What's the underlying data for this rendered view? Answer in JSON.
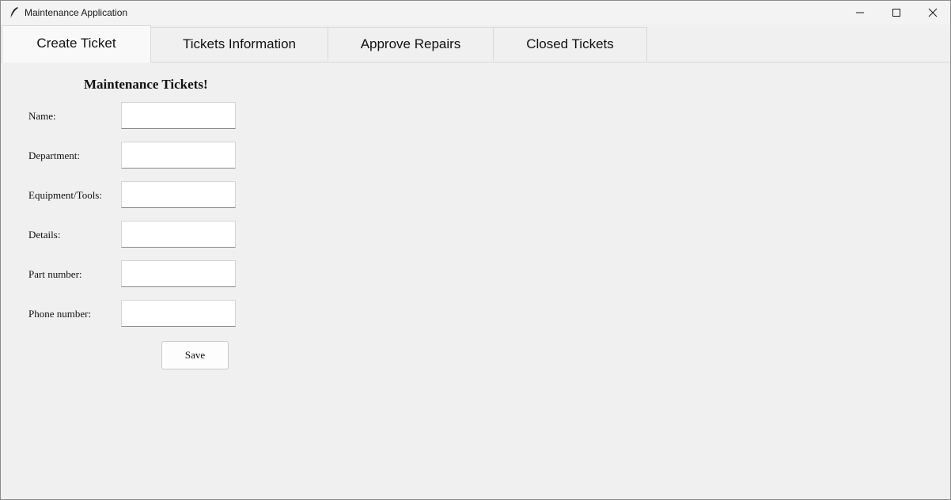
{
  "window": {
    "title": "Maintenance Application",
    "icon": "feather-icon"
  },
  "window_controls": {
    "minimize_icon": "minimize-icon",
    "maximize_icon": "maximize-icon",
    "close_icon": "close-icon"
  },
  "tabs": [
    {
      "label": "Create Ticket",
      "active": true
    },
    {
      "label": "Tickets Information",
      "active": false
    },
    {
      "label": "Approve Repairs",
      "active": false
    },
    {
      "label": "Closed Tickets",
      "active": false
    }
  ],
  "form": {
    "heading": "Maintenance Tickets!",
    "fields": [
      {
        "label": "Name:",
        "value": ""
      },
      {
        "label": "Department:",
        "value": ""
      },
      {
        "label": "Equipment/Tools:",
        "value": ""
      },
      {
        "label": "Details:",
        "value": ""
      },
      {
        "label": "Part number:",
        "value": ""
      },
      {
        "label": "Phone number:",
        "value": ""
      }
    ],
    "save_label": "Save"
  }
}
